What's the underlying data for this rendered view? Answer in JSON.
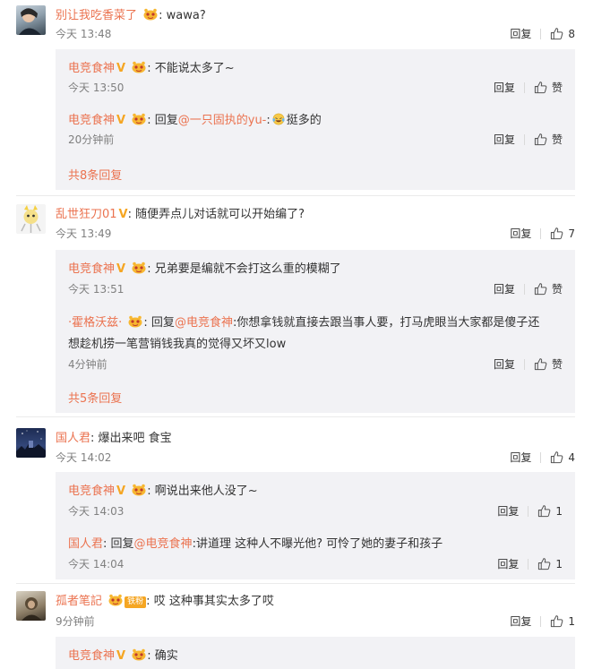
{
  "comments": [
    {
      "user": "别让我吃香菜了",
      "text": "wawa?",
      "time": "今天 13:48",
      "reply_label": "回复",
      "likes": "8",
      "sub_replies": [
        {
          "user": "电竞食神",
          "text": "不能说太多了~",
          "time": "今天 13:50",
          "reply_label": "回复",
          "likes": "赞"
        },
        {
          "user": "电竞食神",
          "reply_prefix": "回复",
          "mention": "@一只固执的yu-",
          "text": "挺多的",
          "time": "20分钟前",
          "reply_label": "回复",
          "likes": "赞"
        }
      ],
      "more": "共8条回复"
    },
    {
      "user": "乱世狂刀01",
      "text": "随便弄点儿对话就可以开始编了?",
      "time": "今天 13:49",
      "reply_label": "回复",
      "likes": "7",
      "sub_replies": [
        {
          "user": "电竞食神",
          "text": "兄弟要是编就不会打这么重的模糊了",
          "time": "今天 13:51",
          "reply_label": "回复",
          "likes": "赞"
        },
        {
          "user": "·霍格沃兹·",
          "reply_prefix": "回复",
          "mention": "@电竞食神",
          "text": ":你想拿钱就直接去跟当事人要，打马虎眼当大家都是傻子还",
          "text2": "想趁机捞一笔营销钱我真的觉得又坏又low",
          "time": "4分钟前",
          "reply_label": "回复",
          "likes": "赞"
        }
      ],
      "more": "共5条回复"
    },
    {
      "user": "国人君",
      "text": "爆出来吧 食宝",
      "time": "今天 14:02",
      "reply_label": "回复",
      "likes": "4",
      "sub_replies": [
        {
          "user": "电竞食神",
          "text": "啊说出来他人没了~",
          "time": "今天 14:03",
          "reply_label": "回复",
          "likes": "1"
        },
        {
          "user": "国人君",
          "reply_prefix": "回复",
          "mention": "@电竞食神",
          "text": ":讲道理 这种人不曝光他? 可怜了她的妻子和孩子",
          "time": "今天 14:04",
          "reply_label": "回复",
          "likes": "1"
        }
      ]
    },
    {
      "user": "孤者笔記",
      "level_badge": "铁粉",
      "text": "哎 这种事其实太多了哎",
      "time": "9分钟前",
      "reply_label": "回复",
      "likes": "1",
      "sub_replies": [
        {
          "user": "电竞食神",
          "text": "确实"
        }
      ]
    }
  ],
  "verified_mark": "V",
  "colors": {
    "username": "#eb7350",
    "subbox_bg": "#f2f2f5",
    "badge": "#f5a623"
  }
}
